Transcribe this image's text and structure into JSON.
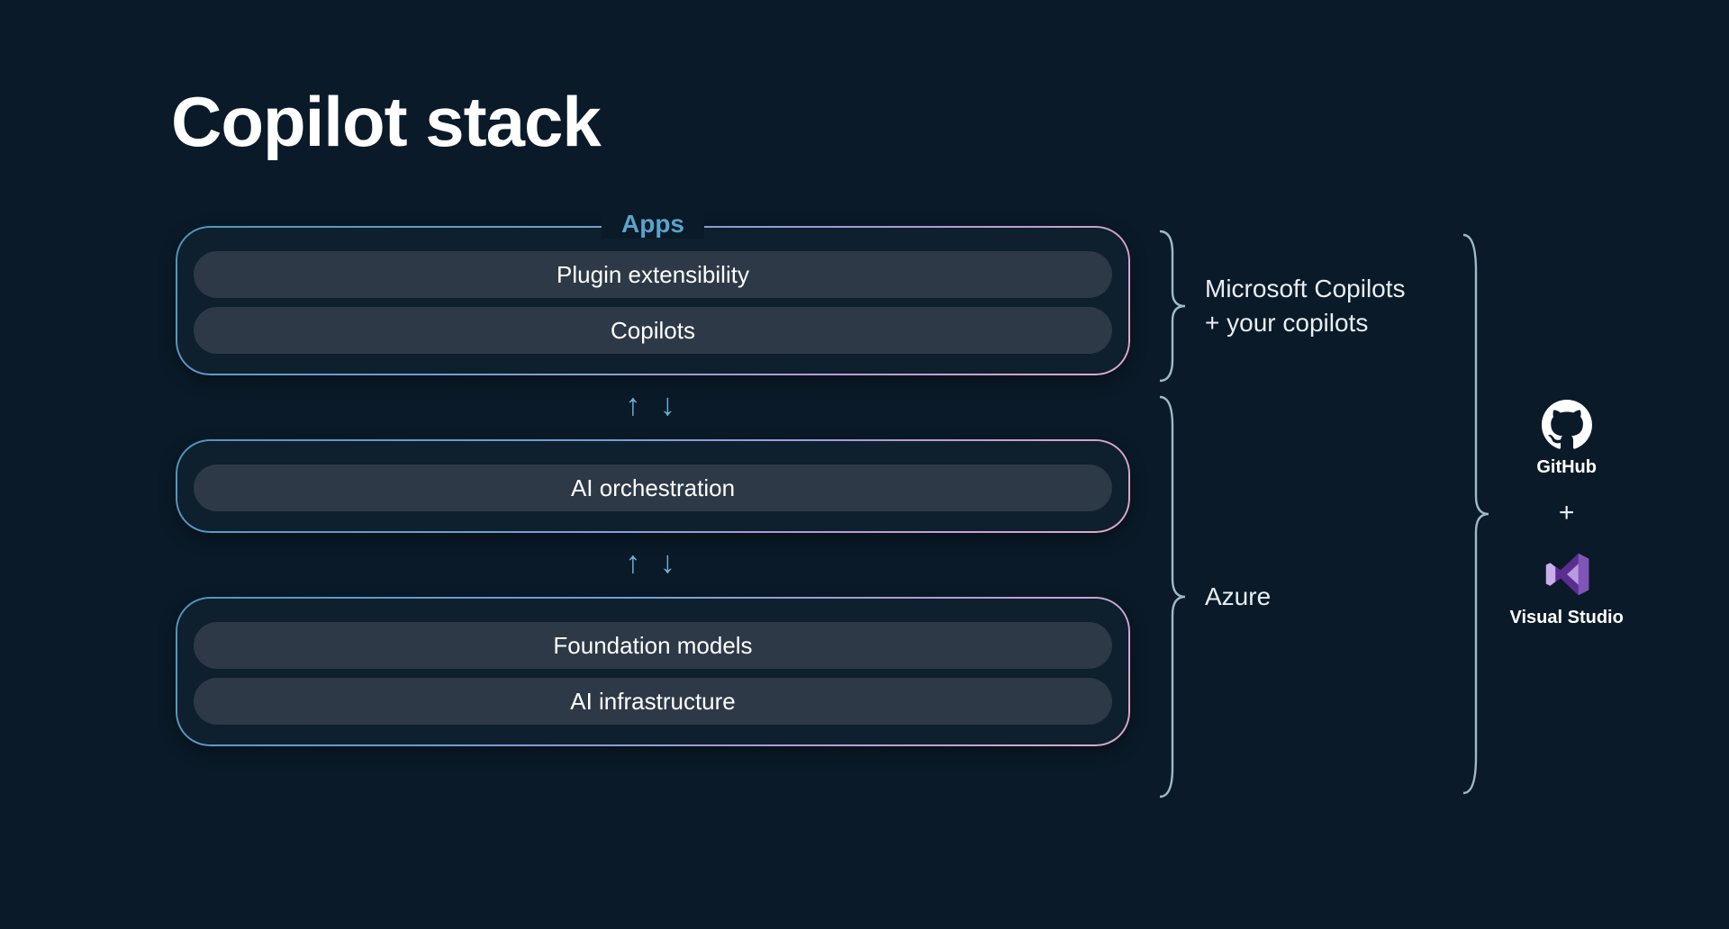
{
  "title": "Copilot stack",
  "groups": {
    "apps": {
      "label": "Apps",
      "items": [
        "Plugin extensibility",
        "Copilots"
      ]
    },
    "orchestration": {
      "items": [
        "AI orchestration"
      ]
    },
    "foundation": {
      "items": [
        "Foundation models",
        "AI infrastructure"
      ]
    }
  },
  "braces": {
    "top": {
      "line1": "Microsoft Copilots",
      "line2": "+ your copilots"
    },
    "bottom": {
      "label": "Azure"
    }
  },
  "tools": {
    "github": "GitHub",
    "vs": "Visual Studio",
    "connector": "+"
  },
  "arrows_glyph": "↑ ↓"
}
